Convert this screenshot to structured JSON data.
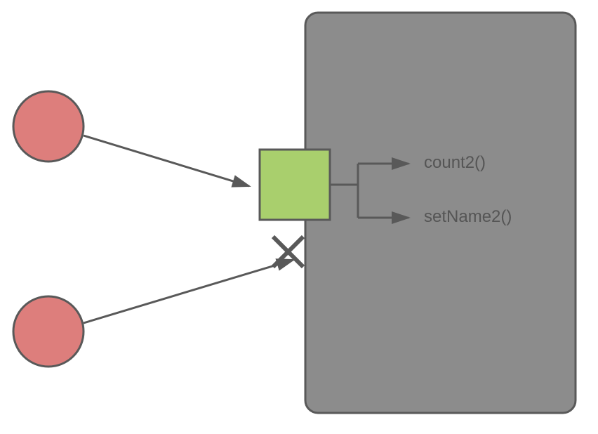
{
  "colors": {
    "circleFill": "#dd7e7c",
    "circleStroke": "#595959",
    "greenBoxFill": "#a9cf6d",
    "greenBoxStroke": "#595959",
    "grayBoxFill": "#8c8c8c",
    "grayBoxStroke": "#595959",
    "arrowStroke": "#595959"
  },
  "methods": {
    "top": "count2()",
    "bottom": "setName2()"
  }
}
